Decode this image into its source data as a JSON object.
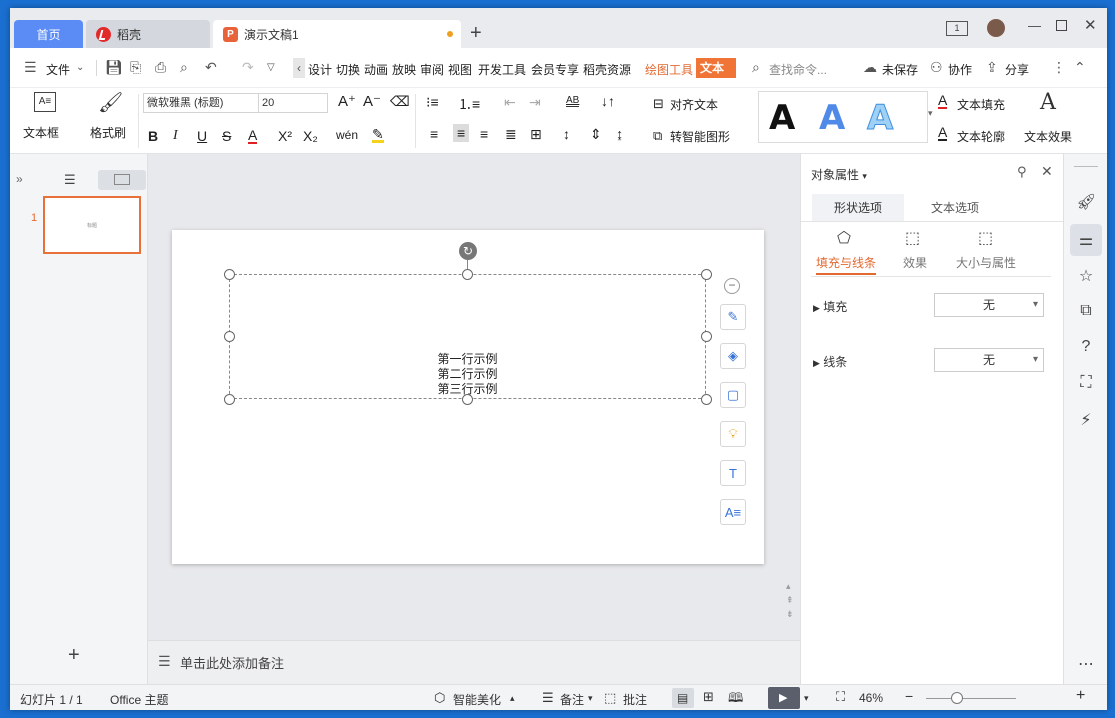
{
  "tabs": {
    "home": "首页",
    "daoke": "稻壳",
    "doc": "演示文稿1",
    "add": "+"
  },
  "menu": {
    "file": "文件",
    "items": [
      "设计",
      "切换",
      "动画",
      "放映",
      "审阅",
      "视图",
      "开发工具",
      "会员专享",
      "稻壳资源"
    ],
    "drawing_tools": "绘图工具",
    "text_tools": "文本工具",
    "search_placeholder": "查找命令...",
    "unsaved": "未保存",
    "collab": "协作",
    "share": "分享"
  },
  "ribbon": {
    "textbox": "文本框",
    "format_painter": "格式刷",
    "font_name": "微软雅黑 (标题)",
    "font_size": "20",
    "align_text": "对齐文本",
    "smart_shape": "转智能图形",
    "text_fill": "文本填充",
    "text_outline": "文本轮廓",
    "text_effect": "文本效果",
    "ab_label": "AB"
  },
  "slides": {
    "number": "1",
    "thumb_text": "标题"
  },
  "slide": {
    "lines": [
      "第一行示例",
      "第二行示例",
      "第三行示例"
    ]
  },
  "notes": {
    "placeholder": "单击此处添加备注"
  },
  "panel": {
    "title": "对象属性",
    "tab_shape": "形状选项",
    "tab_text": "文本选项",
    "sub_fill_line": "填充与线条",
    "sub_effect": "效果",
    "sub_size": "大小与属性",
    "fill_label": "填充",
    "fill_value": "无",
    "line_label": "线条",
    "line_value": "无"
  },
  "status": {
    "slide_count": "幻灯片 1 / 1",
    "theme": "Office 主题",
    "smart_beautify": "智能美化",
    "notes": "备注",
    "comments": "批注",
    "zoom": "46%"
  },
  "colors": {
    "accent_orange": "#e36931",
    "home_tab": "#5b8cf5"
  }
}
